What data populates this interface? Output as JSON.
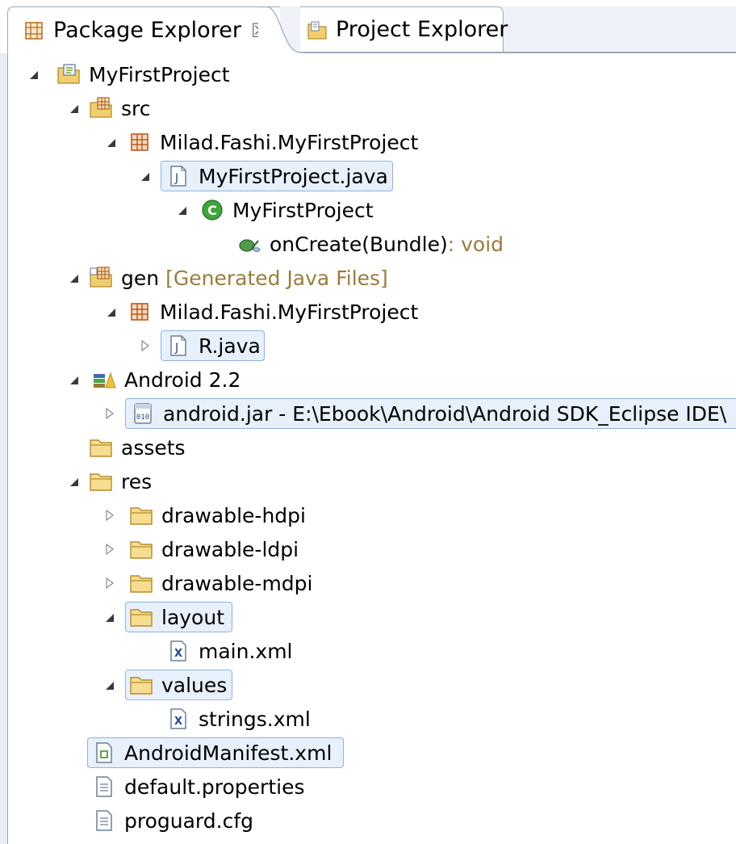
{
  "tabs": [
    {
      "label": "Package Explorer",
      "close": "☒",
      "icon": "package-explorer-icon"
    },
    {
      "label": "Project Explorer",
      "icon": "project-explorer-icon"
    }
  ],
  "tree": [
    {
      "label": "MyFirstProject",
      "icon": "android-project-icon",
      "twisty": "expanded"
    },
    {
      "label": "src",
      "icon": "source-folder-icon",
      "twisty": "expanded"
    },
    {
      "label": "Milad.Fashi.MyFirstProject",
      "icon": "package-icon",
      "twisty": "expanded"
    },
    {
      "label": "MyFirstProject.java",
      "icon": "java-file-icon",
      "twisty": "expanded",
      "selected": true
    },
    {
      "label": "MyFirstProject",
      "icon": "class-icon",
      "twisty": "expanded"
    },
    {
      "label": "onCreate(Bundle)",
      "suffix": " : void",
      "icon": "method-icon",
      "twisty": "none"
    },
    {
      "label": "gen",
      "decoration": "[Generated Java Files]",
      "icon": "gen-folder-icon",
      "twisty": "expanded"
    },
    {
      "label": "Milad.Fashi.MyFirstProject",
      "icon": "package-icon",
      "twisty": "expanded"
    },
    {
      "label": "R.java",
      "icon": "java-file-icon",
      "twisty": "collapsed",
      "selected": true
    },
    {
      "label": "Android 2.2",
      "icon": "library-icon",
      "twisty": "expanded"
    },
    {
      "label": "android.jar - E:\\Ebook\\Android\\Android SDK_Eclipse IDE\\",
      "icon": "jar-icon",
      "twisty": "collapsed",
      "selected": true
    },
    {
      "label": "assets",
      "icon": "folder-icon",
      "twisty": "none"
    },
    {
      "label": "res",
      "icon": "folder-icon",
      "twisty": "expanded"
    },
    {
      "label": "drawable-hdpi",
      "icon": "folder-icon",
      "twisty": "collapsed"
    },
    {
      "label": "drawable-ldpi",
      "icon": "folder-icon",
      "twisty": "collapsed"
    },
    {
      "label": "drawable-mdpi",
      "icon": "folder-icon",
      "twisty": "collapsed"
    },
    {
      "label": "layout",
      "icon": "folder-icon",
      "twisty": "expanded",
      "selected": true
    },
    {
      "label": "main.xml",
      "icon": "xml-file-icon",
      "twisty": "none"
    },
    {
      "label": "values",
      "icon": "folder-icon",
      "twisty": "expanded",
      "selected": true
    },
    {
      "label": "strings.xml",
      "icon": "xml-file-icon",
      "twisty": "none"
    },
    {
      "label": "AndroidManifest.xml",
      "icon": "manifest-file-icon",
      "twisty": "none",
      "selected": true
    },
    {
      "label": "default.properties",
      "icon": "text-file-icon",
      "twisty": "none"
    },
    {
      "label": "proguard.cfg",
      "icon": "text-file-icon",
      "twisty": "none"
    }
  ],
  "colors": {
    "selection_bg": "#e7f0fb",
    "selection_border": "#8fb3dc",
    "decoration_text": "#9b7c3b",
    "tab_border": "#9ca8b7"
  }
}
